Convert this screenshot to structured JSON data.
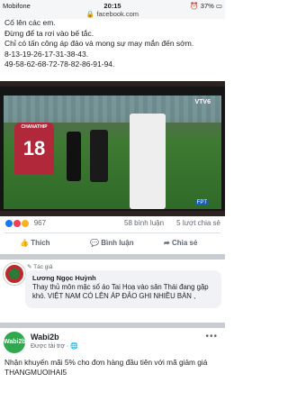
{
  "status_bar": {
    "carrier": "Mobifone",
    "time": "20:15",
    "battery": "37%"
  },
  "url_bar": {
    "domain": "facebook.com"
  },
  "post": {
    "lines": [
      "Cố lên các em.",
      "Đừng để ta rơi vào bế tắc.",
      "Chỉ có tấn công áp đảo và mong sự may mắn đến sớm.",
      "8-13-19-26-17-31-38-43.",
      "49-58-62-68-72-78-82-86-91-94."
    ],
    "photo": {
      "vtv_logo": "VTV6",
      "shirt_name": "CHANATHIP",
      "shirt_number": "18",
      "sponsor": "FPT"
    }
  },
  "reactions": {
    "count": "967",
    "comments": "58 bình luận",
    "shares": "5 lượt chia sẻ"
  },
  "actions": {
    "like": "Thích",
    "comment": "Bình luận",
    "share": "Chia sẻ"
  },
  "comment": {
    "tag": "Tác giả",
    "author": "Lương Ngọc Huỳnh",
    "text": "Thay thủ môn mặc số áo Tai Hoạ vào sân Thái đang gặp khó. VIỆT NAM CÓ LÊN ÁP ĐẢO GHI NHIỀU BÀN ,"
  },
  "ad": {
    "avatar_text": "Wabi2b",
    "page_name": "Wabi2b",
    "sponsored": "Được tài trợ · ",
    "body": "Nhận khuyến mãi 5% cho đơn hàng đầu tiên với mã giảm giá THANGMUOIHAI5"
  },
  "colors": {
    "like_blue": "#1877f2",
    "love_red": "#f33e58",
    "brand_green": "#2fa84f"
  }
}
